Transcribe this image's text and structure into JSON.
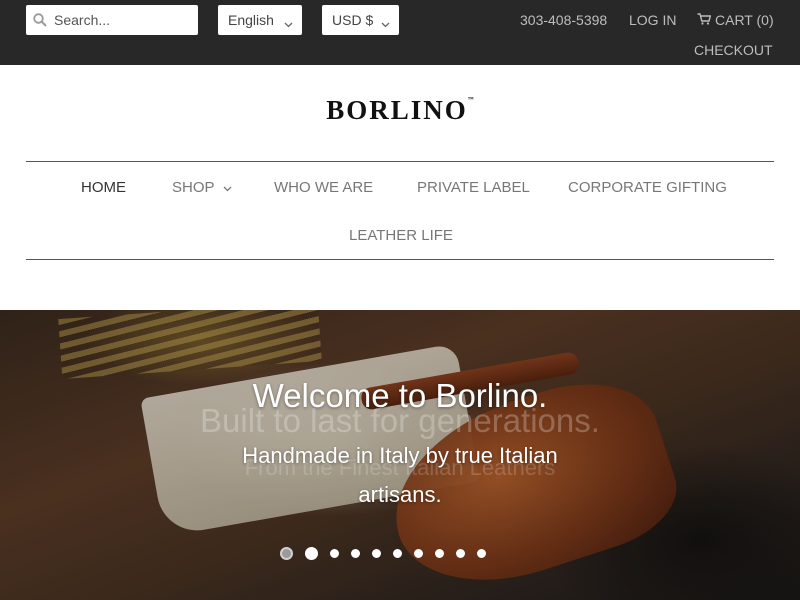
{
  "topbar": {
    "search": {
      "placeholder": "Search...",
      "value": "",
      "icon": "search-icon"
    },
    "language": {
      "selected": "English",
      "icon": "chevron-down-icon"
    },
    "currency": {
      "selected": "USD $",
      "icon": "chevron-down-icon"
    },
    "phone": "303-408-5398",
    "login_label": "LOG IN",
    "cart": {
      "label": "CART (0)",
      "icon": "cart-icon"
    },
    "checkout_label": "CHECKOUT",
    "background_color": "#282828"
  },
  "header": {
    "logo_text": "BORLINO",
    "logo_mark": "™"
  },
  "nav": {
    "items": [
      {
        "label": "HOME",
        "active": true
      },
      {
        "label": "SHOP",
        "has_dropdown": true
      },
      {
        "label": "WHO WE ARE"
      },
      {
        "label": "PRIVATE LABEL"
      },
      {
        "label": "CORPORATE GIFTING"
      },
      {
        "label": "LEATHER LIFE"
      }
    ]
  },
  "hero": {
    "title": "Welcome to Borlino.",
    "subtitle": "Handmade in Italy by true Italian artisans.",
    "ghost_title": "Built to last for generations.",
    "ghost_subtitle": "From the Finest Italian Leathers",
    "slide_count": 10,
    "active_slide": 1
  }
}
